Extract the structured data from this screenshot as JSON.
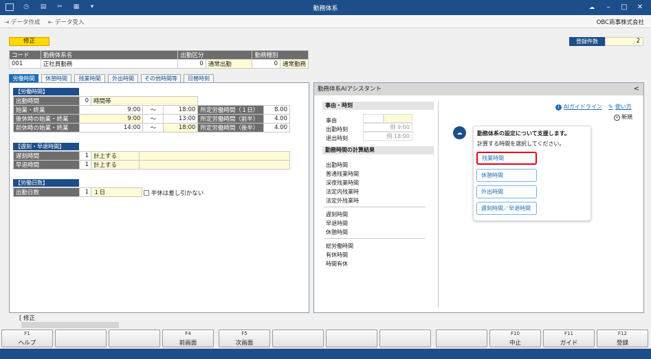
{
  "window": {
    "title": "勤務体系"
  },
  "toolbar": {
    "data_create": "データ作成",
    "data_import": "データ受入",
    "company": "OBC商事株式会社"
  },
  "mode": {
    "label": "修正"
  },
  "register": {
    "label": "登録件数",
    "value": "2"
  },
  "header_table": {
    "headers": [
      "コード",
      "勤務体系名",
      "出勤区分",
      "",
      "勤務種別",
      ""
    ],
    "row": [
      "001",
      "正社員勤務",
      "0",
      "通常出勤",
      "0",
      "通常勤務"
    ]
  },
  "tabs": [
    "労働時間",
    "休憩時間",
    "残業時間",
    "外出時間",
    "その他時間等",
    "日替時刻"
  ],
  "labor": {
    "section": "【労働時間】",
    "r1": {
      "label": "出勤時間",
      "v": "0",
      "t": "時間帯"
    },
    "r2": {
      "label": "始業・終業",
      "a": "9:00",
      "sep": "〜",
      "b": "18:00",
      "l2": "所定労働時間（１日）",
      "c": "8.00"
    },
    "r3": {
      "label": "後休時の始業・終業",
      "a": "9:00",
      "sep": "〜",
      "b": "13:00",
      "l2": "所定労働時間（前半）",
      "c": "4.00"
    },
    "r4": {
      "label": "前休時の始業・終業",
      "a": "14:00",
      "sep": "〜",
      "b": "18:00",
      "l2": "所定労働時間（後半）",
      "c": "4.00"
    }
  },
  "late": {
    "section": "【遅刻・早退時間】",
    "r1": {
      "label": "遅刻時間",
      "v": "1",
      "t": "計上する"
    },
    "r2": {
      "label": "早退時間",
      "v": "1",
      "t": "計上する"
    }
  },
  "days": {
    "section": "【労働日数】",
    "r1": {
      "label": "出勤日数",
      "v": "1",
      "t": "１日"
    },
    "half": "半休は差し引かない"
  },
  "assistant": {
    "title": "勤務体系AIアシスタント",
    "collapse": "<",
    "reason_header": "事由・時刻",
    "reason_labels": [
      "事由",
      "出勤時刻",
      "退出時刻"
    ],
    "ex_in": "例 9:00",
    "ex_out": "例 18:00",
    "calc_header": "勤務時間の計算結果",
    "group1": [
      "出勤時間",
      "普通残業時間",
      "深夜残業時間",
      "法定内残業時",
      "法定外残業時"
    ],
    "group2": [
      "遅刻時間",
      "早退時間",
      "休憩時間"
    ],
    "group3": [
      "総労働時間",
      "有休時間",
      "時間有休"
    ],
    "guide": "AIガイドライン",
    "howto": "使い方",
    "new": "新規",
    "msg1": "勤務体系の設定について支援します。",
    "msg2": "計算する時間を選択してください。",
    "choices": [
      "残業時間",
      "休憩時間",
      "外出時間",
      "遅刻時間／早退時間"
    ]
  },
  "status": {
    "label": "[ 修正"
  },
  "fkeys": [
    {
      "n": "F1",
      "l": "ヘルプ"
    },
    {
      "n": "",
      "l": ""
    },
    {
      "n": "",
      "l": ""
    },
    {
      "n": "F4",
      "l": "前画面"
    },
    {
      "n": "F5",
      "l": "次画面"
    },
    {
      "n": "",
      "l": ""
    },
    {
      "n": "",
      "l": ""
    },
    {
      "n": "",
      "l": ""
    },
    {
      "n": "",
      "l": ""
    },
    {
      "n": "F10",
      "l": "中止"
    },
    {
      "n": "F11",
      "l": "ガイド"
    },
    {
      "n": "F12",
      "l": "登録"
    }
  ],
  "colors": {
    "brand": "#1d4e89",
    "accent": "#1d6fb8",
    "highlight": "#e0001a",
    "input": "#fffbd6"
  }
}
